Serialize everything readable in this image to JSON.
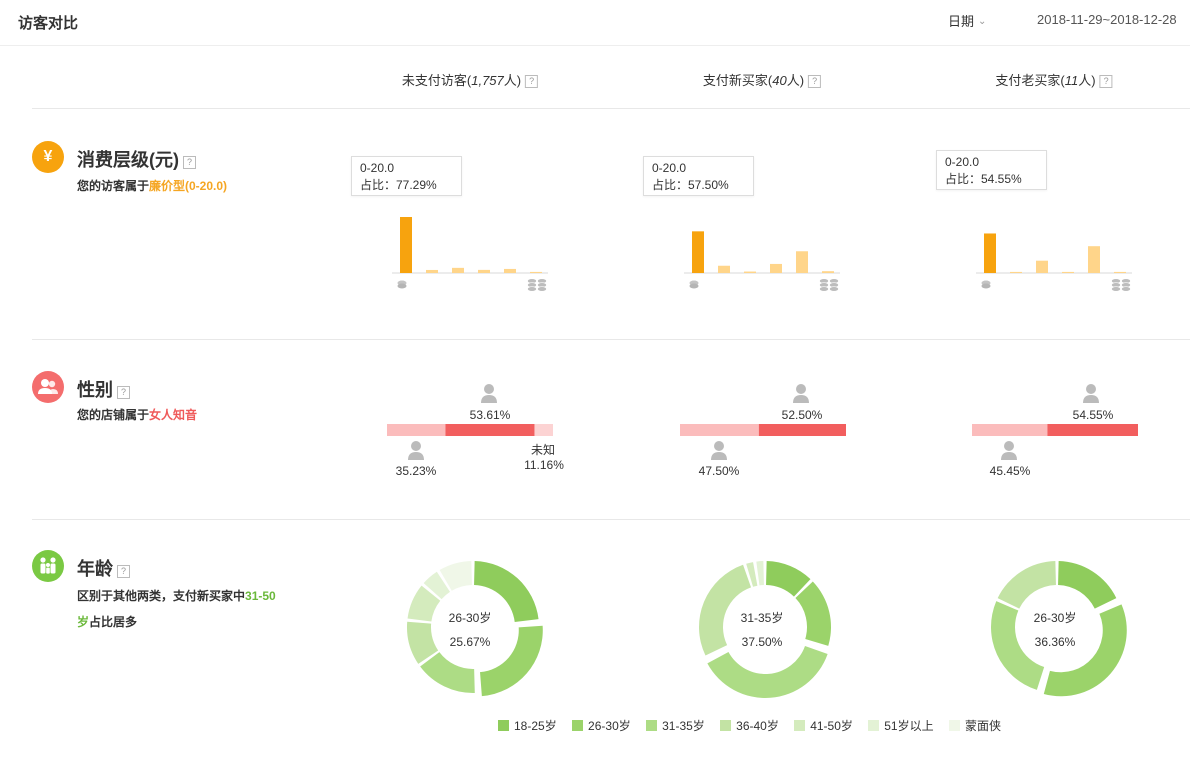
{
  "header": {
    "title": "访客对比",
    "date_label": "日期",
    "date_range": "2018-11-29~2018-12-28"
  },
  "columns": [
    {
      "label": "未支付访客",
      "count": "1,757",
      "unit": "人"
    },
    {
      "label": "支付新买家",
      "count": "40",
      "unit": "人"
    },
    {
      "label": "支付老买家",
      "count": "11",
      "unit": "人"
    }
  ],
  "spend": {
    "title": "消费层级(元)",
    "icon": "yen-icon",
    "icon_glyph": "¥",
    "desc_prefix": "您的访客属于",
    "desc_highlight": "廉价型(0-20.0)",
    "colors": {
      "active": "#f7a30e",
      "inactive": "#ffd58a"
    },
    "tooltips": [
      {
        "range": "0-20.0",
        "share": "占比：77.29%"
      },
      {
        "range": "0-20.0",
        "share": "占比：57.50%"
      },
      {
        "range": "0-20.0",
        "share": "占比：54.55%"
      }
    ],
    "chart_data": [
      {
        "type": "bar",
        "values": [
          77.29,
          4.2,
          7.1,
          4.3,
          5.6,
          1.5
        ]
      },
      {
        "type": "bar",
        "values": [
          57.5,
          10.0,
          2.0,
          12.5,
          30.0,
          2.5
        ]
      },
      {
        "type": "bar",
        "values": [
          54.55,
          1.5,
          17.0,
          1.5,
          37.0,
          1.5
        ]
      }
    ]
  },
  "gender": {
    "title": "性别",
    "icon": "users-icon",
    "desc_prefix": "您的店铺属于",
    "desc_highlight": "女人知音",
    "colors": {
      "female": "#f25e5e",
      "male": "#fbbcbc",
      "unknown": "#fcd3d3"
    },
    "groups": [
      {
        "female": 53.61,
        "male": 35.23,
        "unknown": 11.16,
        "female_label": "53.61%",
        "male_label": "35.23%",
        "unknown_name": "未知",
        "unknown_label": "11.16%"
      },
      {
        "female": 52.5,
        "male": 47.5,
        "unknown": 0,
        "female_label": "52.50%",
        "male_label": "47.50%"
      },
      {
        "female": 54.55,
        "male": 45.45,
        "unknown": 0,
        "female_label": "54.55%",
        "male_label": "45.45%"
      }
    ]
  },
  "age": {
    "title": "年龄",
    "icon": "family-icon",
    "desc_prefix": "区别于其他两类，支付新买家中",
    "desc_highlight": "31-50岁",
    "desc_suffix": "占比居多",
    "legend": [
      {
        "name": "18-25岁",
        "color": "#8fcc5c"
      },
      {
        "name": "26-30岁",
        "color": "#9bd36a"
      },
      {
        "name": "31-35岁",
        "color": "#addc85"
      },
      {
        "name": "36-40岁",
        "color": "#c3e3a4"
      },
      {
        "name": "41-50岁",
        "color": "#d4ebbd"
      },
      {
        "name": "51岁以上",
        "color": "#e3f2d5"
      },
      {
        "name": "蒙面侠",
        "color": "#f0f7e8"
      }
    ],
    "chart_data": [
      {
        "type": "pie",
        "center_name": "26-30岁",
        "center_value": "25.67%",
        "values": [
          23.5,
          25.67,
          16.0,
          11.5,
          9.5,
          5.0,
          8.83
        ]
      },
      {
        "type": "pie",
        "center_name": "31-35岁",
        "center_value": "37.50%",
        "values": [
          12.5,
          17.5,
          37.5,
          27.5,
          2.5,
          2.5,
          0
        ]
      },
      {
        "type": "pie",
        "center_name": "26-30岁",
        "center_value": "36.36%",
        "values": [
          18.18,
          36.36,
          27.27,
          18.19,
          0,
          0,
          0
        ]
      }
    ]
  }
}
